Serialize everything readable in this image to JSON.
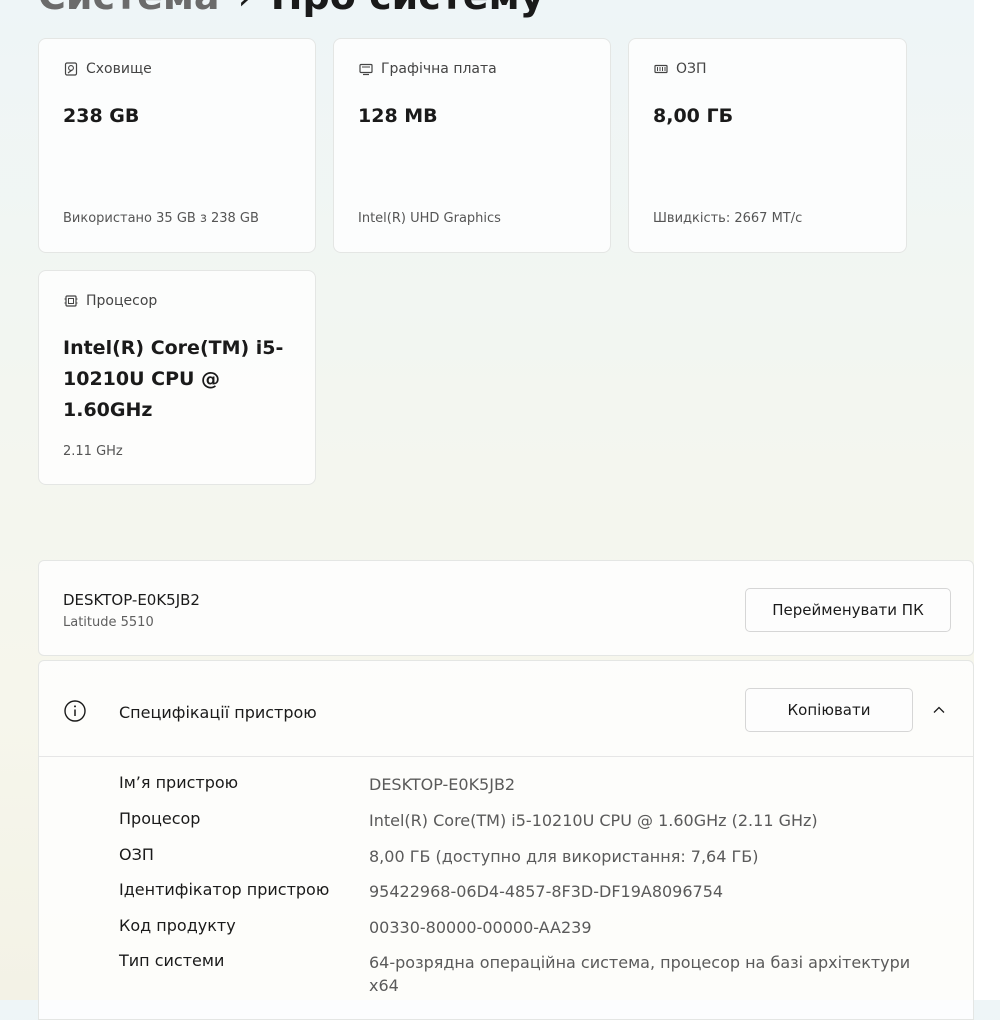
{
  "header": {
    "crumb": "Система",
    "separator": "›",
    "title": "Про систему"
  },
  "cards": {
    "storage": {
      "label": "Сховище",
      "value": "238 GB",
      "detail": "Використано 35 GB з 238 GB",
      "icon": "storage-icon"
    },
    "graphics": {
      "label": "Графічна плата",
      "value": "128 MB",
      "detail": "Intel(R) UHD Graphics",
      "icon": "graphics-card-icon"
    },
    "ram": {
      "label": "ОЗП",
      "value": "8,00 ГБ",
      "detail": "Швидкість: 2667 MT/с",
      "icon": "ram-icon"
    },
    "cpu": {
      "label": "Процесор",
      "value": "Intel(R) Core(TM) i5-10210U CPU @ 1.60GHz",
      "detail": "2.11 GHz",
      "icon": "cpu-icon"
    }
  },
  "pc": {
    "name": "DESKTOP-E0K5JB2",
    "model": "Latitude 5510",
    "rename_label": "Перейменувати ПК"
  },
  "specs": {
    "title": "Специфікації пристрою",
    "copy_label": "Копіювати",
    "rows": [
      {
        "key": "Ім’я пристрою",
        "value": "DESKTOP-E0K5JB2"
      },
      {
        "key": "Процесор",
        "value": "Intel(R) Core(TM) i5-10210U CPU @ 1.60GHz (2.11 GHz)"
      },
      {
        "key": "ОЗП",
        "value": "8,00 ГБ (доступно для використання: 7,64 ГБ)"
      },
      {
        "key": "Ідентифікатор пристрою",
        "value": "95422968-06D4-4857-8F3D-DF19A8096754"
      },
      {
        "key": "Код продукту",
        "value": "00330-80000-00000-AA239"
      },
      {
        "key": "Тип системи",
        "value": "64-розрядна операційна система, процесор на базі архітектури x64"
      }
    ]
  }
}
